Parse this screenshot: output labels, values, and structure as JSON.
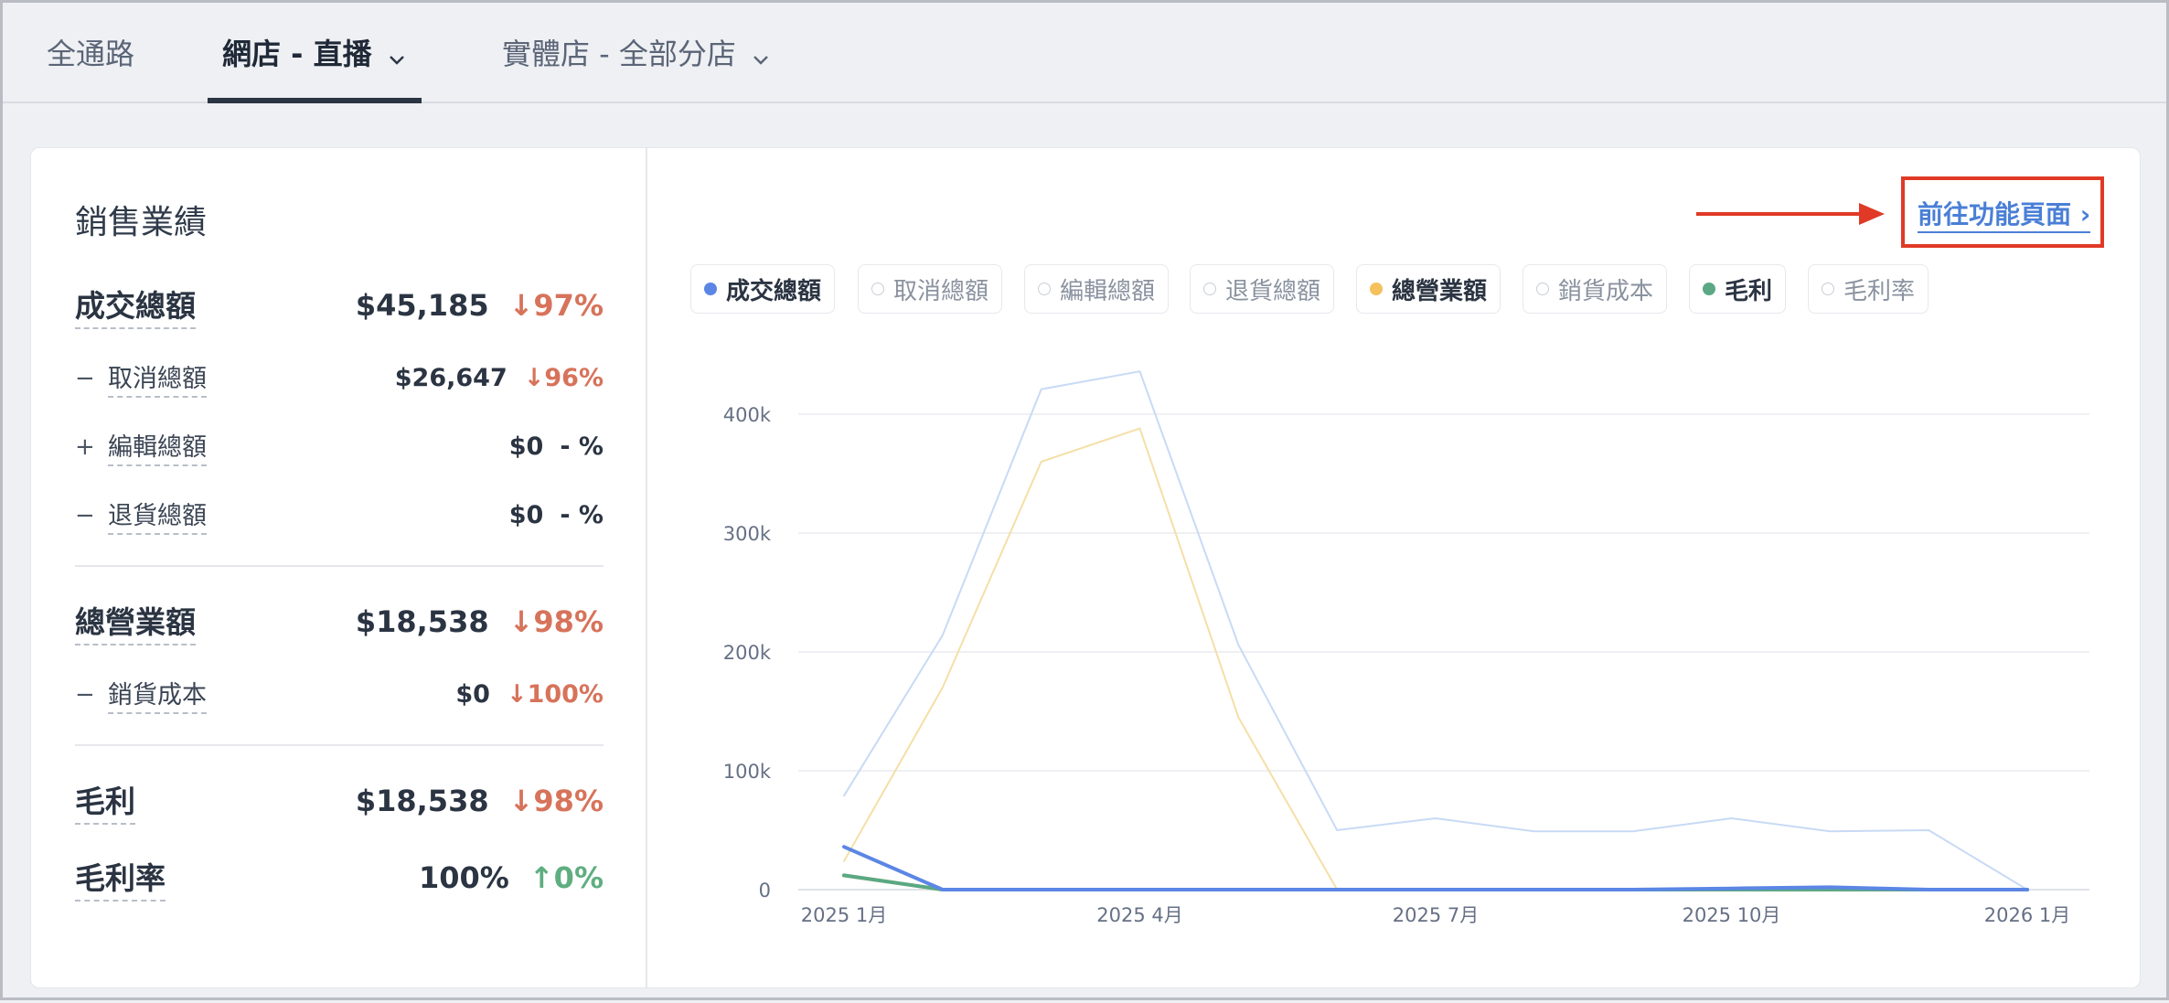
{
  "tabs": [
    {
      "label": "全通路",
      "active": false,
      "dropdown": false
    },
    {
      "label": "網店 - 直播",
      "active": true,
      "dropdown": true
    },
    {
      "label": "實體店 - 全部分店",
      "active": false,
      "dropdown": true
    }
  ],
  "summary": {
    "title": "銷售業績",
    "rows": [
      {
        "sign": "",
        "label": "成交總額",
        "value": "$45,185",
        "change": "↓97%",
        "trend": "down",
        "level": "major"
      },
      {
        "sign": "−",
        "label": "取消總額",
        "value": "$26,647",
        "change": "↓96%",
        "trend": "down",
        "level": "minor"
      },
      {
        "sign": "+",
        "label": "編輯總額",
        "value": "$0",
        "change": "- %",
        "trend": "neutral",
        "level": "minor"
      },
      {
        "sign": "−",
        "label": "退貨總額",
        "value": "$0",
        "change": "- %",
        "trend": "neutral",
        "level": "minor"
      },
      {
        "sign": "",
        "label": "總營業額",
        "value": "$18,538",
        "change": "↓98%",
        "trend": "down",
        "level": "major"
      },
      {
        "sign": "−",
        "label": "銷貨成本",
        "value": "$0",
        "change": "↓100%",
        "trend": "down",
        "level": "minor"
      },
      {
        "sign": "",
        "label": "毛利",
        "value": "$18,538",
        "change": "↓98%",
        "trend": "down",
        "level": "major"
      },
      {
        "sign": "",
        "label": "毛利率",
        "value": "100%",
        "change": "↑0%",
        "trend": "up",
        "level": "major"
      }
    ]
  },
  "goto_link": "前往功能頁面 ›",
  "legend": [
    {
      "label": "成交總額",
      "active": true,
      "color": "#5b86e5"
    },
    {
      "label": "取消總額",
      "active": false,
      "color": "#c9ced6"
    },
    {
      "label": "編輯總額",
      "active": false,
      "color": "#c9ced6"
    },
    {
      "label": "退貨總額",
      "active": false,
      "color": "#c9ced6"
    },
    {
      "label": "總營業額",
      "active": true,
      "color": "#f4c15d"
    },
    {
      "label": "銷貨成本",
      "active": false,
      "color": "#c9ced6"
    },
    {
      "label": "毛利",
      "active": true,
      "color": "#5aa885"
    },
    {
      "label": "毛利率",
      "active": false,
      "color": "#c9ced6"
    }
  ],
  "chart_data": {
    "type": "line",
    "x": [
      "2025-01",
      "2025-02",
      "2025-03",
      "2025-04",
      "2025-05",
      "2025-06",
      "2025-07",
      "2025-08",
      "2025-09",
      "2025-10",
      "2025-11",
      "2025-12",
      "2026-01"
    ],
    "x_tick_labels": [
      {
        "x": "2025-01",
        "label": "2025 1月"
      },
      {
        "x": "2025-04",
        "label": "2025 4月"
      },
      {
        "x": "2025-07",
        "label": "2025 7月"
      },
      {
        "x": "2025-10",
        "label": "2025 10月"
      },
      {
        "x": "2026-01",
        "label": "2026 1月"
      }
    ],
    "y_ticks": [
      0,
      100000,
      200000,
      300000,
      400000
    ],
    "y_tick_labels": [
      "0",
      "100k",
      "200k",
      "300k",
      "400k"
    ],
    "ylim": [
      0,
      430000
    ],
    "grid": true,
    "series": [
      {
        "name": "",
        "color": "#c8daf5",
        "width": 2,
        "values": [
          79000,
          214000,
          421000,
          436000,
          206000,
          50000,
          60000,
          49000,
          49000,
          60000,
          49000,
          50000,
          0
        ]
      },
      {
        "name": "",
        "color": "#f4dfa6",
        "width": 2,
        "values": [
          24000,
          170000,
          360000,
          388000,
          145000,
          0,
          0,
          0,
          0,
          0,
          0,
          0,
          0
        ]
      },
      {
        "name": "總營業額",
        "color": "#f4c15d",
        "width": 4,
        "values": [
          12000,
          0,
          0,
          0,
          0,
          0,
          0,
          0,
          0,
          0,
          0,
          0,
          0
        ]
      },
      {
        "name": "毛利",
        "color": "#5aa885",
        "width": 4,
        "values": [
          12000,
          0,
          0,
          0,
          0,
          0,
          0,
          0,
          0,
          0,
          0,
          0,
          0
        ]
      },
      {
        "name": "成交總額",
        "color": "#5b86e5",
        "width": 4,
        "values": [
          36000,
          0,
          0,
          0,
          0,
          0,
          0,
          0,
          0,
          1000,
          2000,
          0,
          0
        ]
      }
    ]
  }
}
